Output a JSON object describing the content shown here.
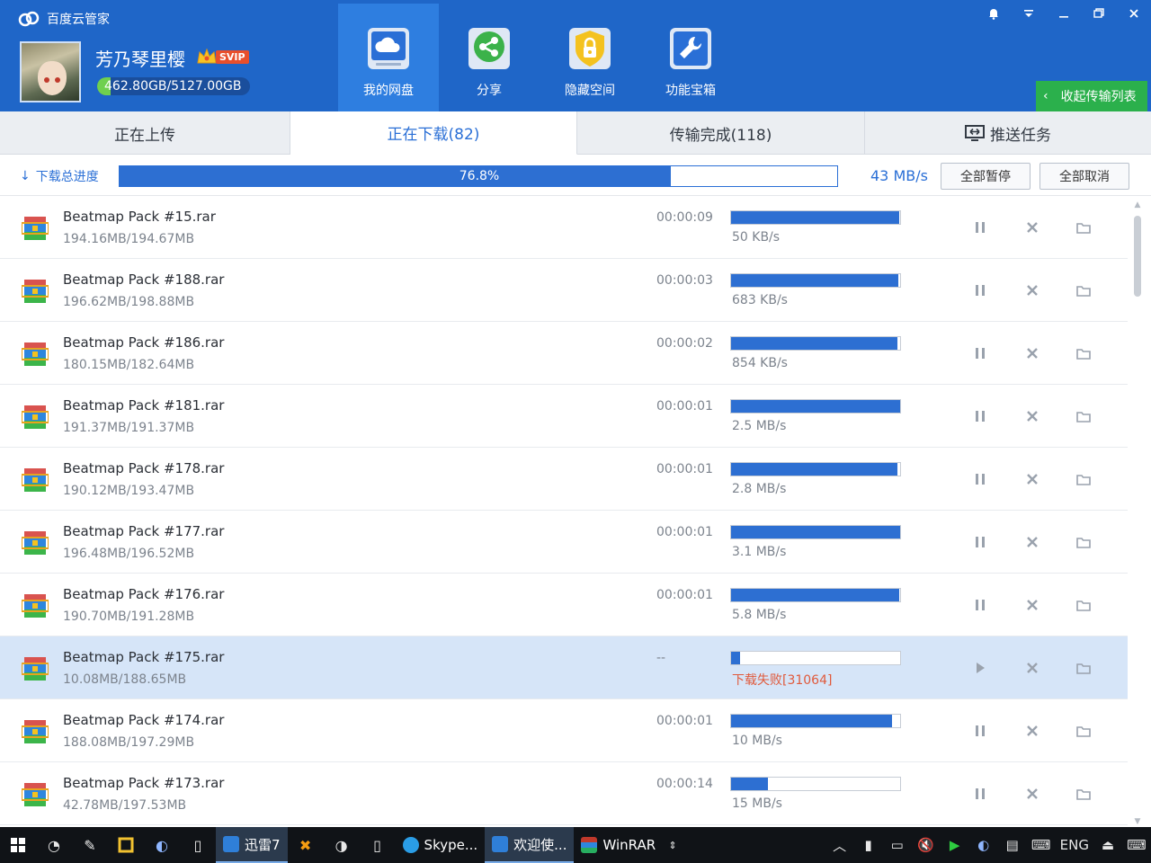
{
  "app": {
    "title": "百度云管家",
    "username": "芳乃琴里樱",
    "vip_label": "SVIP",
    "quota_text": "462.80GB/5127.00GB",
    "quota_fraction": 0.09
  },
  "nav": [
    {
      "label": "我的网盘",
      "icon": "cloud-drive-icon",
      "active": true
    },
    {
      "label": "分享",
      "icon": "share-icon",
      "active": false
    },
    {
      "label": "隐藏空间",
      "icon": "lock-icon",
      "active": false
    },
    {
      "label": "功能宝箱",
      "icon": "toolbox-icon",
      "active": false
    }
  ],
  "window_controls": [
    "bell-icon",
    "dropdown-icon",
    "minimize-icon",
    "restore-icon",
    "close-icon"
  ],
  "collapse_transfer_label": "收起传输列表",
  "tabs": {
    "uploading": "正在上传",
    "downloading": "正在下载(82)",
    "completed": "传输完成(118)",
    "push": "推送任务"
  },
  "overall": {
    "label": "下载总进度",
    "progress_fraction": 0.768,
    "progress_text": "76.8%",
    "speed": "43 MB/s",
    "pause_all": "全部暂停",
    "cancel_all": "全部取消"
  },
  "downloads": [
    {
      "name": "Beatmap Pack #15.rar",
      "size": "194.16MB/194.67MB",
      "time": "00:00:09",
      "progress": 0.997,
      "status": "50 KB/s",
      "state": "downloading"
    },
    {
      "name": "Beatmap Pack #188.rar",
      "size": "196.62MB/198.88MB",
      "time": "00:00:03",
      "progress": 0.989,
      "status": "683 KB/s",
      "state": "downloading"
    },
    {
      "name": "Beatmap Pack #186.rar",
      "size": "180.15MB/182.64MB",
      "time": "00:00:02",
      "progress": 0.986,
      "status": "854 KB/s",
      "state": "downloading"
    },
    {
      "name": "Beatmap Pack #181.rar",
      "size": "191.37MB/191.37MB",
      "time": "00:00:01",
      "progress": 1.0,
      "status": "2.5 MB/s",
      "state": "downloading"
    },
    {
      "name": "Beatmap Pack #178.rar",
      "size": "190.12MB/193.47MB",
      "time": "00:00:01",
      "progress": 0.983,
      "status": "2.8 MB/s",
      "state": "downloading"
    },
    {
      "name": "Beatmap Pack #177.rar",
      "size": "196.48MB/196.52MB",
      "time": "00:00:01",
      "progress": 1.0,
      "status": "3.1 MB/s",
      "state": "downloading"
    },
    {
      "name": "Beatmap Pack #176.rar",
      "size": "190.70MB/191.28MB",
      "time": "00:00:01",
      "progress": 0.997,
      "status": "5.8 MB/s",
      "state": "downloading"
    },
    {
      "name": "Beatmap Pack #175.rar",
      "size": "10.08MB/188.65MB",
      "time": "--",
      "progress": 0.053,
      "status": "下载失败[31064]",
      "state": "failed"
    },
    {
      "name": "Beatmap Pack #174.rar",
      "size": "188.08MB/197.29MB",
      "time": "00:00:01",
      "progress": 0.953,
      "status": "10 MB/s",
      "state": "downloading"
    },
    {
      "name": "Beatmap Pack #173.rar",
      "size": "42.78MB/197.53MB",
      "time": "00:00:14",
      "progress": 0.217,
      "status": "15 MB/s",
      "state": "downloading"
    }
  ],
  "taskbar": {
    "apps": [
      {
        "label": "迅雷7",
        "icon": "thunder-icon",
        "open": true
      },
      {
        "label": "Skype...",
        "icon": "skype-icon",
        "open": false
      },
      {
        "label": "欢迎使...",
        "icon": "baidu-cloud-icon",
        "open": true
      },
      {
        "label": "WinRAR",
        "icon": "winrar-icon",
        "open": false
      }
    ],
    "lang": "ENG"
  },
  "colors": {
    "header_blue": "#1f66c8",
    "active_nav": "#2e7ee0",
    "progress_blue": "#2d6fd2",
    "collapse_green": "#2bb04c",
    "error_red": "#e05a3c",
    "selected_row": "#d6e5f8"
  }
}
